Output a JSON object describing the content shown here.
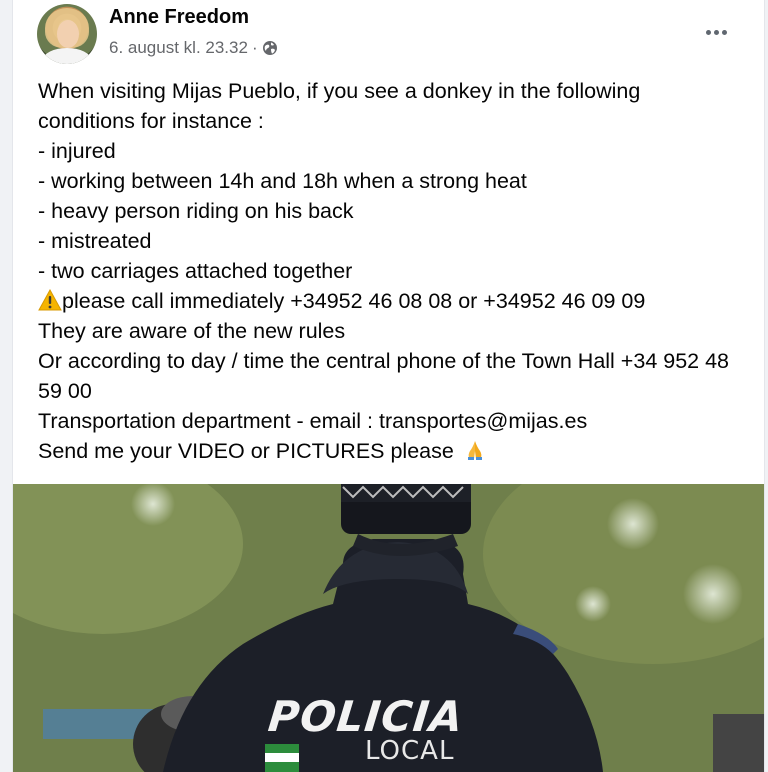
{
  "post": {
    "author": "Anne Freedom",
    "date": "6. august kl. 23.32",
    "separator": "·",
    "privacy_icon": "globe-icon",
    "more_icon": "more-horizontal-icon",
    "lines": {
      "l1": "When visiting Mijas Pueblo, if you see a donkey in the following",
      "l2": "conditions for instance :",
      "l3": "- injured",
      "l4": "- working between 14h and 18h when a strong heat",
      "l5": "- heavy person riding on his back",
      "l6": "- mistreated",
      "l7": "- two carriages attached together",
      "l8": "please call immediately +34952 46 08 08 or +34952 46 09 09",
      "l9": "They are aware of the new rules",
      "l10": "Or according to day / time the central phone of the Town Hall +34 952 48 59 00",
      "l11": "Transportation department - email : transportes@mijas.es",
      "l12": "Send me your VIDEO or PICTURES please"
    },
    "warning_icon": "warning-icon",
    "pray_icon": "folded-hands-icon"
  },
  "photo": {
    "jacket_text": "POLICIA",
    "jacket_subtext": "LOCAL"
  },
  "colors": {
    "text": "#050505",
    "secondary_text": "#65676b",
    "background": "#f0f2f5"
  }
}
